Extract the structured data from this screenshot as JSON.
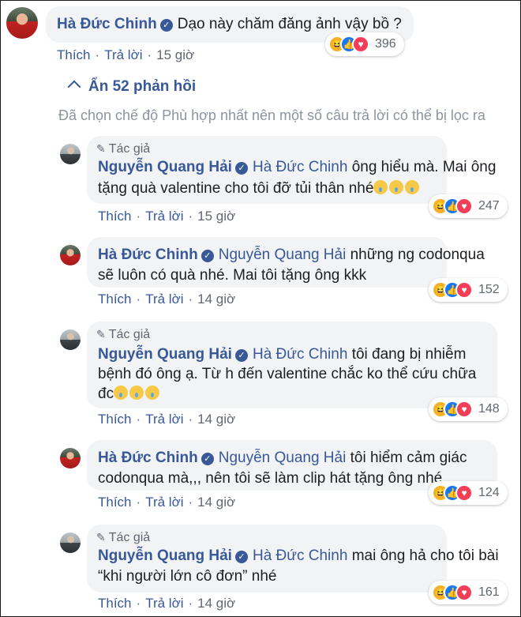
{
  "top_comment": {
    "author": "Hà Đức Chinh",
    "text": "Dạo này chăm đăng ảnh vậy bồ ?",
    "actions": {
      "like": "Thích",
      "reply": "Trả lời",
      "time": "15 giờ"
    },
    "reaction_count": "396"
  },
  "replies_toggle": {
    "arrow": "^",
    "label": "Ẩn 52 phản hồi"
  },
  "notice": "Đã chọn chế độ Phù hợp nhất nên một số câu trả lời có thể bị lọc ra",
  "replies": [
    {
      "badge": "Tác giả",
      "author": "Nguyễn Quang Hải",
      "mention": "Hà Đức Chinh",
      "line1": "ông hiểu mà. Mai ông",
      "line2": "tặng quà valentine cho tôi đỡ tủi thân nhé",
      "like": "Thích",
      "reply": "Trả lời",
      "time": "15 giờ",
      "count": "247"
    },
    {
      "badge": "",
      "author": "Hà Đức Chinh",
      "mention": "Nguyễn Quang Hải",
      "line1": "những ng codonqua",
      "line2": "sẽ luôn có quà nhé. Mai tôi tặng ông kkk",
      "like": "Thích",
      "reply": "Trả lời",
      "time": "14 giờ",
      "count": "152"
    },
    {
      "badge": "Tác giả",
      "author": "Nguyễn Quang Hải",
      "mention": "Hà Đức Chinh",
      "line1": "tôi đang bị nhiễm",
      "line2": "bệnh đó ông ạ. Từ h đến valentine chắc ko thể cứu chữa",
      "line3": "đc",
      "like": "Thích",
      "reply": "Trả lời",
      "time": "14 giờ",
      "count": "148"
    },
    {
      "badge": "",
      "author": "Hà Đức Chinh",
      "mention": "Nguyễn Quang Hải",
      "line1": "tôi hiểm cảm giác",
      "line2": "codonqua mà,,, nên tôi sẽ làm clip hát tặng ông nhé",
      "like": "Thích",
      "reply": "Trả lời",
      "time": "14 giờ",
      "count": "124"
    },
    {
      "badge": "Tác giả",
      "author": "Nguyễn Quang Hải",
      "mention": "Hà Đức Chinh",
      "line1": "mai ông hả cho tôi bài",
      "line2": "“khi người lớn cô đơn” nhé",
      "like": "Thích",
      "reply": "Trả lời",
      "time": "14 giờ",
      "count": "161"
    }
  ],
  "colors": {
    "link": "#385898",
    "bubble": "#f2f3f5",
    "muted": "#606770",
    "like": "#1877f2",
    "love": "#f33e58",
    "haha": "#f7b125"
  },
  "icons": {
    "verified": "verified-check-icon",
    "author_badge": "pencil-icon",
    "reactions": [
      "haha-icon",
      "like-icon",
      "love-icon"
    ],
    "emoji": "sad-tear-emoji-icon"
  }
}
